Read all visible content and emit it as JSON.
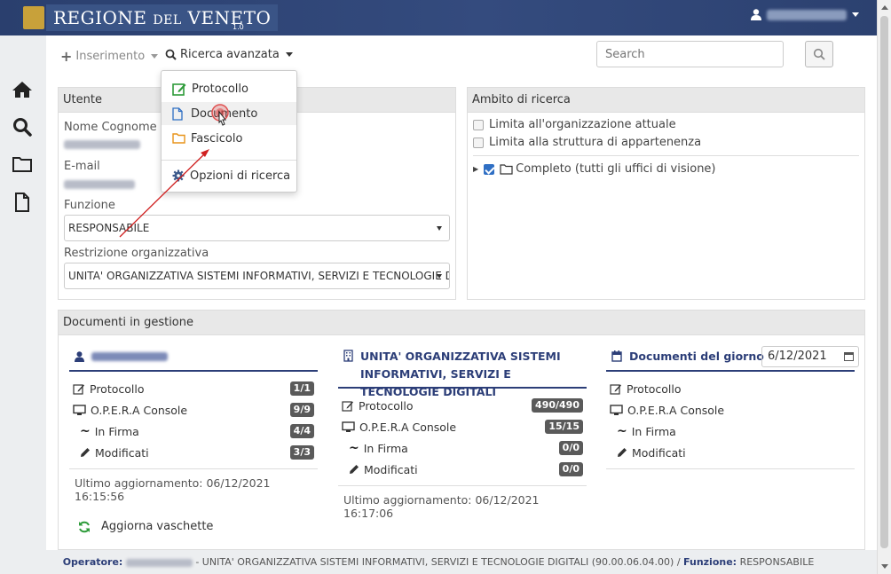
{
  "header": {
    "brand_main": "REGIONE",
    "brand_small": "DEL",
    "brand_end": "VENETO",
    "version": "1.0"
  },
  "toolbar": {
    "inserimento": "Inserimento",
    "ricerca_avanzata": "Ricerca avanzata",
    "search_placeholder": "Search"
  },
  "dropdown": {
    "items": [
      "Protocollo",
      "Documento",
      "Fascicolo",
      "Opzioni di ricerca"
    ]
  },
  "utente": {
    "title": "Utente",
    "nome_label": "Nome Cognome",
    "email_label": "E-mail",
    "funzione_label": "Funzione",
    "funzione_value": "RESPONSABILE",
    "restrizione_label": "Restrizione organizzativa",
    "restrizione_value": "UNITA' ORGANIZZATIVA SISTEMI INFORMATIVI, SERVIZI E TECNOLOGIE DIGITALI"
  },
  "ambito": {
    "title": "Ambito di ricerca",
    "opt1": "Limita all'organizzazione attuale",
    "opt2": "Limita alla struttura di appartenenza",
    "tree_item": "Completo (tutti gli uffici di visione)"
  },
  "docs": {
    "title": "Documenti in gestione",
    "col2_title": "UNITA' ORGANIZZATIVA SISTEMI INFORMATIVI, SERVIZI E TECNOLOGIE DIGITALI",
    "col3_title": "Documenti del giorno",
    "date": "6/12/2021",
    "labels": {
      "protocollo": "Protocollo",
      "console": "O.P.E.R.A Console",
      "firma": "In Firma",
      "modificati": "Modificati"
    },
    "col1": {
      "protocollo": "1/1",
      "console": "9/9",
      "firma": "4/4",
      "modificati": "3/3",
      "updated": "Ultimo aggiornamento: 06/12/2021 16:15:56"
    },
    "col2": {
      "protocollo": "490/490",
      "console": "15/15",
      "firma": "0/0",
      "modificati": "0/0",
      "updated": "Ultimo aggiornamento: 06/12/2021 16:17:06"
    },
    "refresh": "Aggiorna vaschette"
  },
  "footer": {
    "operatore_label": "Operatore:",
    "unit_text": "- UNITA' ORGANIZZATIVA SISTEMI INFORMATIVI, SERVIZI E TECNOLOGIE DIGITALI (90.00.06.04.00) /",
    "funzione_label": "Funzione:",
    "funzione_value": "RESPONSABILE"
  }
}
